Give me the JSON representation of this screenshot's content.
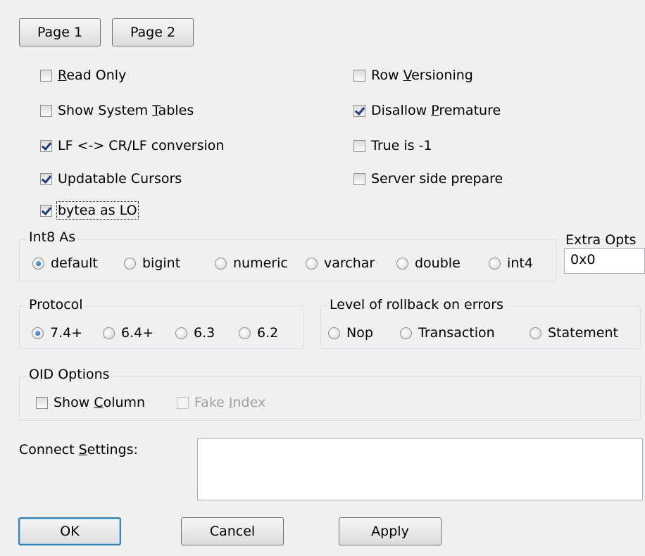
{
  "tabs": {
    "page1": "Page 1",
    "page2": "Page 2"
  },
  "checkboxes": {
    "read_only": {
      "pre": "",
      "u": "R",
      "post": "ead Only",
      "checked": false
    },
    "show_system_tables": {
      "pre": "Show System ",
      "u": "T",
      "post": "ables",
      "checked": false
    },
    "lf_conversion": {
      "pre": "LF <-> CR/LF conversion",
      "u": "",
      "post": "",
      "checked": true
    },
    "updatable_cursors": {
      "pre": "Updatable Cursors",
      "u": "",
      "post": "",
      "checked": true
    },
    "bytea_as_lo": {
      "pre": "bytea as LO",
      "u": "",
      "post": "",
      "checked": true
    },
    "row_versioning": {
      "pre": "Row ",
      "u": "V",
      "post": "ersioning",
      "checked": false
    },
    "disallow_premature": {
      "pre": "Disallow ",
      "u": "P",
      "post": "remature",
      "checked": true
    },
    "true_is_minus1": {
      "pre": "True is -1",
      "u": "",
      "post": "",
      "checked": false
    },
    "server_side_prepare": {
      "pre": "Server side prepare",
      "u": "",
      "post": "",
      "checked": false
    }
  },
  "int8": {
    "legend": "Int8 As",
    "options": [
      "default",
      "bigint",
      "numeric",
      "varchar",
      "double",
      "int4"
    ],
    "selected": "default"
  },
  "extra_opts": {
    "label": "Extra Opts",
    "value": "0x0"
  },
  "protocol": {
    "legend": "Protocol",
    "options": [
      "7.4+",
      "6.4+",
      "6.3",
      "6.2"
    ],
    "selected": "7.4+"
  },
  "rollback": {
    "legend": "Level of rollback on errors",
    "options": [
      "Nop",
      "Transaction",
      "Statement"
    ],
    "selected": ""
  },
  "oid": {
    "legend": "OID Options",
    "show_column": {
      "pre": "Show ",
      "u": "C",
      "post": "olumn",
      "checked": false
    },
    "fake_index": {
      "pre": "Fake ",
      "u": "I",
      "post": "ndex",
      "checked": false,
      "disabled": true
    }
  },
  "connect_settings": {
    "pre": "Connect ",
    "u": "S",
    "post": "ettings:",
    "value": ""
  },
  "buttons": {
    "ok": "OK",
    "cancel": "Cancel",
    "apply": "Apply"
  }
}
